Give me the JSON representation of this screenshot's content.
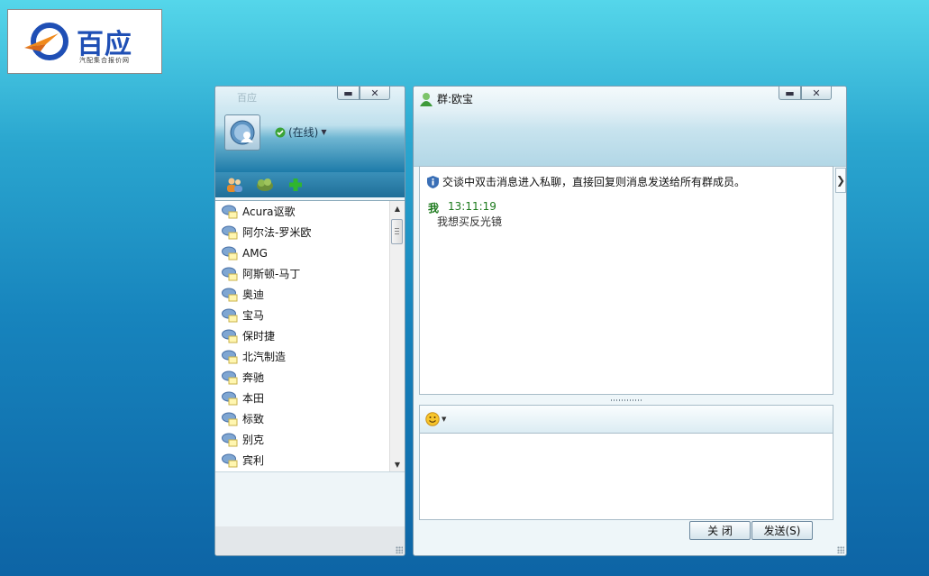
{
  "logo": {
    "name": "百应",
    "tagline": "汽配集合报价网"
  },
  "buddy_window": {
    "title": "百应",
    "status_label": "(在线)",
    "toolbar_icons": [
      "contacts-icon",
      "group-icon",
      "add-icon"
    ],
    "groups": [
      "Acura讴歌",
      "阿尔法-罗米欧",
      "AMG",
      "阿斯顿-马丁",
      "奥迪",
      "宝马",
      "保时捷",
      "北汽制造",
      "奔驰",
      "本田",
      "标致",
      "别克",
      "宾利"
    ]
  },
  "chat_window": {
    "title": "群:欧宝",
    "notice": "交谈中双击消息进入私聊，直接回复则消息发送给所有群成员。",
    "messages": [
      {
        "sender": "我",
        "time": "13:11:19",
        "text": "我想买反光镜"
      }
    ],
    "input_value": "",
    "close_label": "关 闭",
    "send_label": "发送(S)"
  },
  "colors": {
    "background_top": "#55d6ea",
    "background_bottom": "#0d64a5",
    "brand_blue": "#1f4fb5",
    "brand_orange": "#f08a1c",
    "sender_green": "#1d7a1d"
  }
}
